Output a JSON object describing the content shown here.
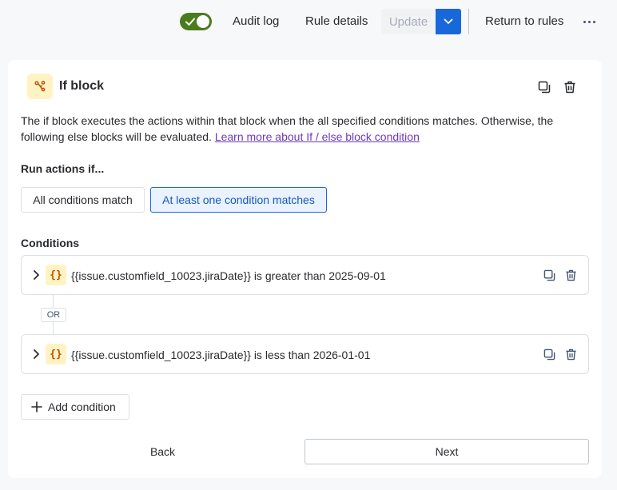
{
  "topbar": {
    "rule_enabled": true,
    "audit_log_label": "Audit log",
    "rule_details_label": "Rule details",
    "update_label": "Update",
    "return_label": "Return to rules"
  },
  "block": {
    "title": "If block",
    "description": "The if block executes the actions within that block when the all specified conditions matches. Otherwise, the following else blocks will be evaluated.",
    "learn_more_link": "Learn more about If / else block condition"
  },
  "run_actions": {
    "label": "Run actions if...",
    "options": [
      "All conditions match",
      "At least one condition matches"
    ],
    "selected": "At least one condition matches"
  },
  "conditions": {
    "label": "Conditions",
    "operator": "OR",
    "items": [
      {
        "icon": "{}",
        "text": "{{issue.customfield_10023.jiraDate}} is greater than 2025-09-01"
      },
      {
        "icon": "{}",
        "text": "{{issue.customfield_10023.jiraDate}} is less than 2026-01-01"
      }
    ],
    "add_label": "Add condition"
  },
  "footer": {
    "back_label": "Back",
    "next_label": "Next"
  },
  "colors": {
    "toggle_on": "#4a7c1f",
    "primary": "#1868db",
    "selected_bg": "#e9f2fe",
    "smart_value_bg": "#fff3c4",
    "smart_value_fg": "#c25100",
    "link": "#6e3ab8"
  }
}
